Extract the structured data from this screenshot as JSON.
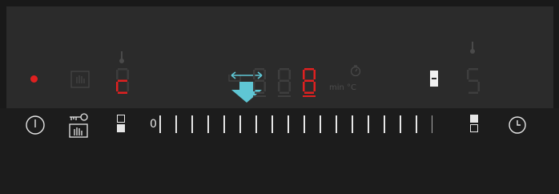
{
  "display": {
    "power_indicator_color": "#e02020",
    "heat_digit": "c",
    "zone_indicator": "▬",
    "timer_digits": [
      "8",
      "8",
      "8"
    ],
    "timer_unit_min": "min",
    "timer_unit_temp": "°C",
    "right_digit": "5"
  },
  "controls": {
    "slider_start_label": "0",
    "slider_tick_count": 18,
    "power_icon": "power-icon",
    "childlock_icon": "key-lock-icon",
    "zone_select_icon": "zone-select-icon",
    "timer_icon": "clock-icon"
  },
  "colors": {
    "active_red": "#e02020",
    "arrow_teal": "#5fc6d4",
    "panel_dark": "#2b2b2b"
  },
  "slider_value": 0
}
